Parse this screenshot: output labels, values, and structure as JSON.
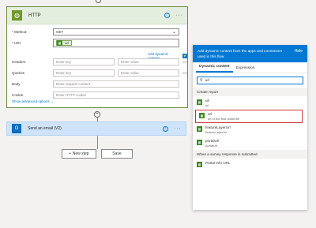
{
  "http_card": {
    "title": "HTTP",
    "method_label": "Method",
    "method_value": "GET",
    "uri_label": "URI",
    "uri_token": "url",
    "add_dynamic": "Add dynamic content",
    "headers_label": "Headers",
    "queries_label": "Queries",
    "body_label": "Body",
    "cookie_label": "Cookie",
    "enter_key": "Enter key",
    "enter_value": "Enter value",
    "enter_body": "Enter request content",
    "enter_cookie": "Enter HTTP cookie",
    "show_advanced": "Show advanced options"
  },
  "email_card": {
    "title": "Send an email (V2)"
  },
  "buttons": {
    "new_step": "+ New step",
    "save": "Save"
  },
  "dynamic_panel": {
    "header_text": "Add dynamic content from the apps and connectors used in this flow.",
    "hide": "Hide",
    "tab_dynamic": "Dynamic content",
    "tab_expression": "Expression",
    "search_value": "url",
    "section1": "Create report",
    "items1": [
      {
        "name": "url",
        "desc": "url"
      },
      {
        "name": "url",
        "desc": "url of the first result file"
      },
      {
        "name": "featureLayerUrl",
        "desc": "featureLayerUrl"
      },
      {
        "name": "portalUrl",
        "desc": "portalUrl"
      }
    ],
    "section2": "When a survey response is submitted",
    "items2": [
      {
        "name": "Portal Info URL",
        "desc": ""
      }
    ]
  },
  "colors": {
    "accent": "#0078d4",
    "http_green": "#709727",
    "highlight": "#d13438"
  }
}
